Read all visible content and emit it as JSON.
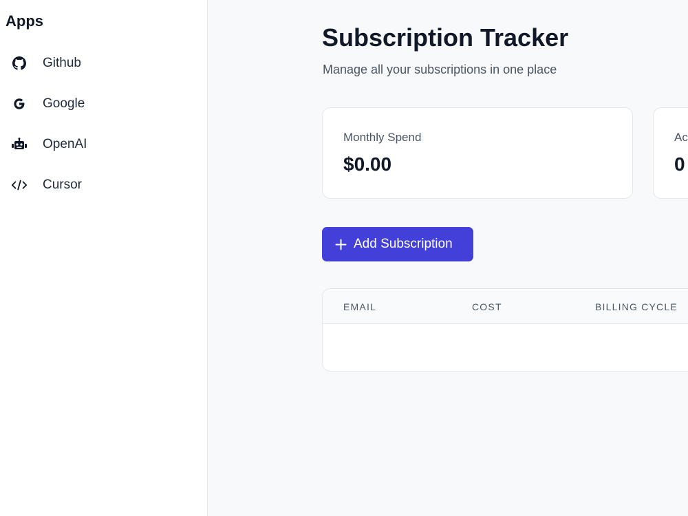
{
  "sidebar": {
    "title": "Apps",
    "items": [
      {
        "label": "Github",
        "icon": "github-icon"
      },
      {
        "label": "Google",
        "icon": "google-icon"
      },
      {
        "label": "OpenAI",
        "icon": "robot-icon"
      },
      {
        "label": "Cursor",
        "icon": "code-icon"
      }
    ]
  },
  "main": {
    "title": "Subscription Tracker",
    "subtitle": "Manage all your subscriptions in one place",
    "stats": [
      {
        "label": "Monthly Spend",
        "value": "$0.00"
      },
      {
        "label": "Ac",
        "value": "0"
      }
    ],
    "add_button_label": "Add Subscription",
    "table": {
      "columns": [
        "EMAIL",
        "COST",
        "BILLING CYCLE"
      ],
      "rows": []
    }
  },
  "colors": {
    "accent": "#4340d9",
    "background": "#f8f9fb",
    "sidebar_background": "#ffffff"
  }
}
